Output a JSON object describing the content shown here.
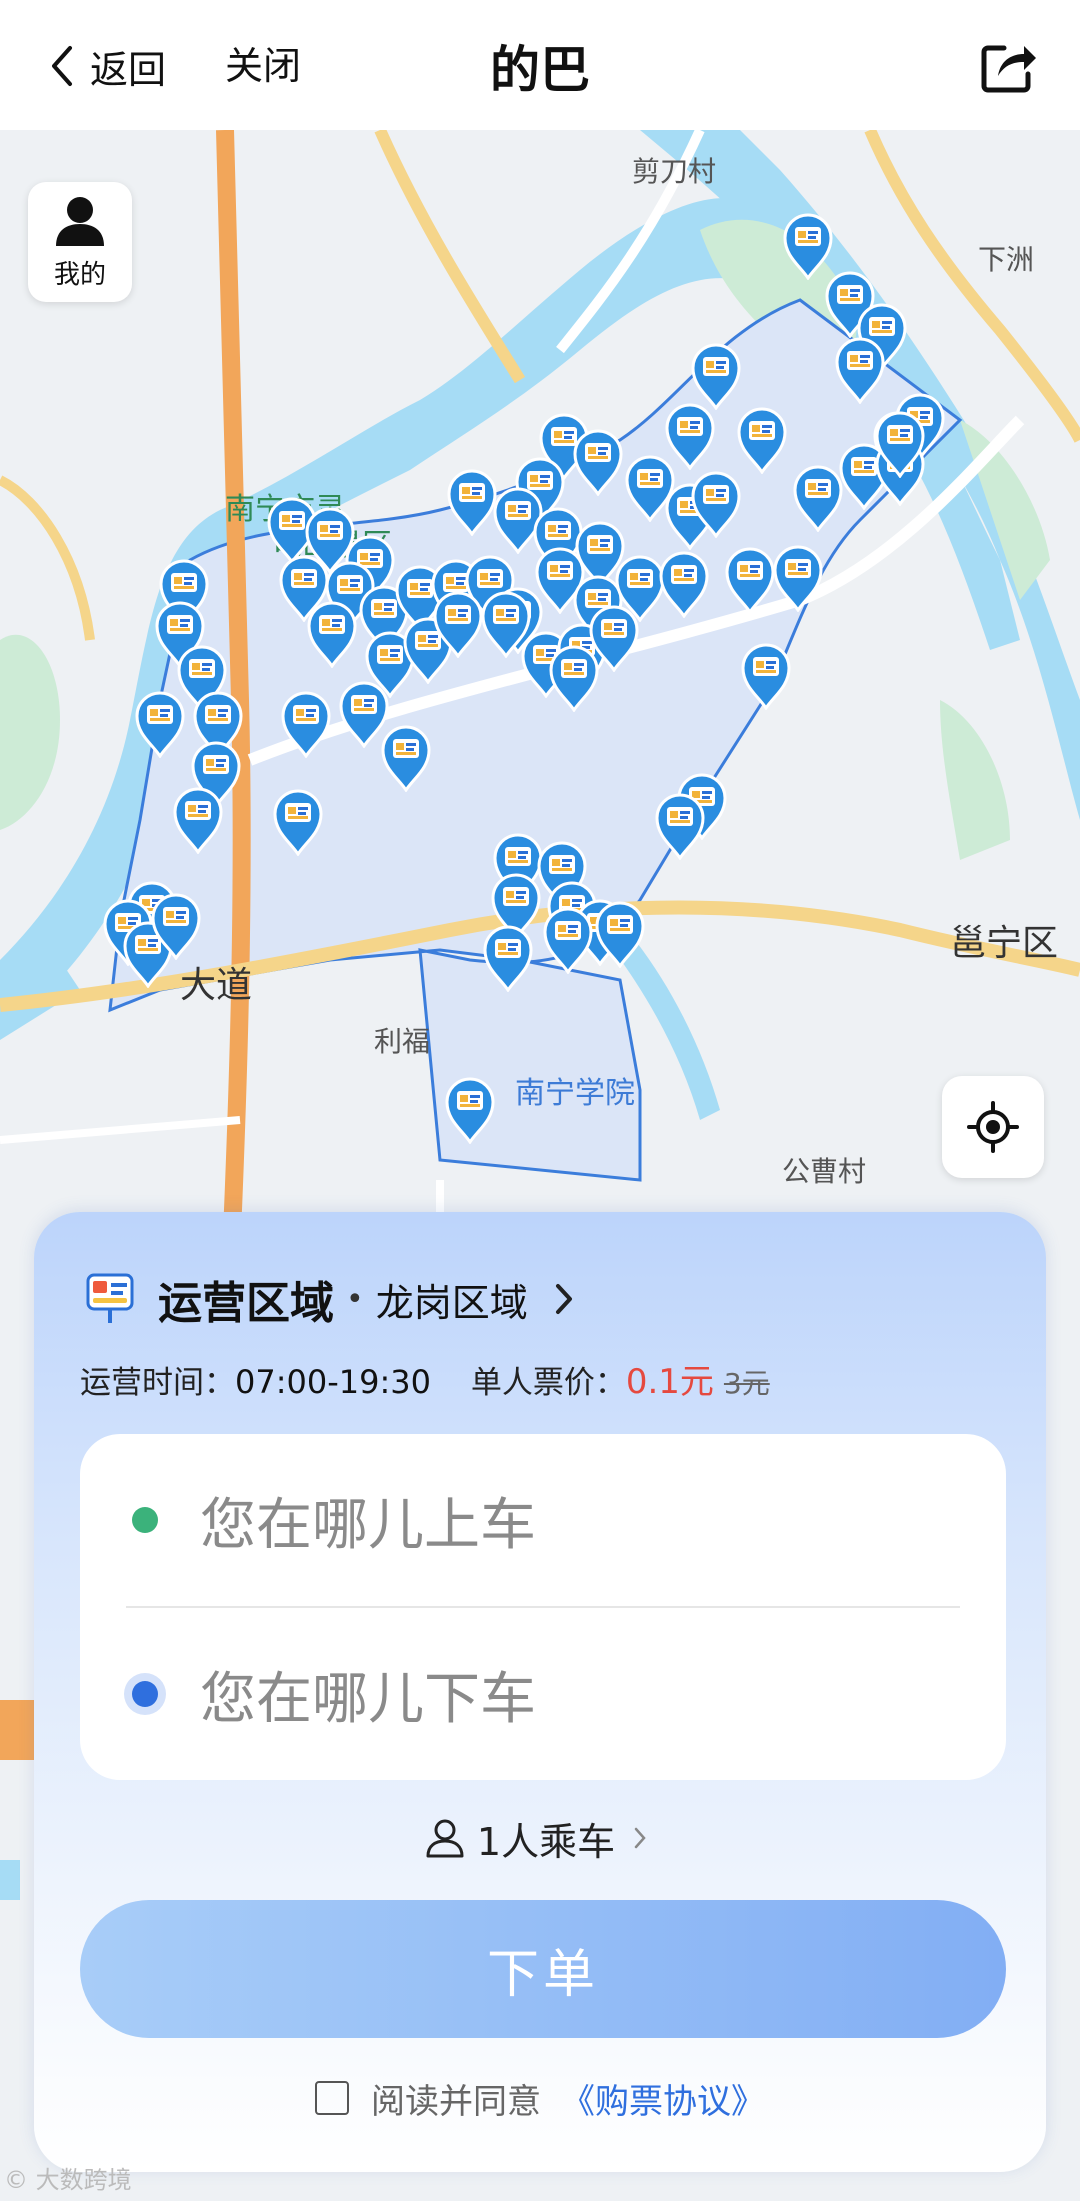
{
  "header": {
    "back_label": "返回",
    "close_label": "关闭",
    "title": "的巴"
  },
  "map": {
    "me_label": "我的",
    "labels": {
      "jiandao": "剪刀村",
      "xiazhou": "下洲",
      "lingguishan_1": "南宁市灵",
      "lingguishan_2": "龟山景区",
      "yongning": "邕宁区",
      "dadao": "大道",
      "lifu": "利福",
      "nanning_xueyuan": "南宁学院",
      "gongcao": "公曹村"
    }
  },
  "panel": {
    "zone_title": "运营区域",
    "zone_dot": "•",
    "zone_name": "龙岗区域",
    "hours_label": "运营时间：",
    "hours_value": "07:00-19:30",
    "fare_label": "单人票价：",
    "fare_price": "0.1元",
    "fare_original": "3元",
    "pickup_placeholder": "您在哪儿上车",
    "dropoff_placeholder": "您在哪儿下车",
    "riders_label": "1人乘车",
    "order_button": "下单",
    "agree_text": "阅读并同意",
    "agreement_link": "《购票协议》"
  },
  "colors": {
    "accent_blue": "#2f6fde",
    "pin_blue": "#2a8de0",
    "price_red": "#e5493f",
    "pickup_green": "#3bb27b"
  }
}
